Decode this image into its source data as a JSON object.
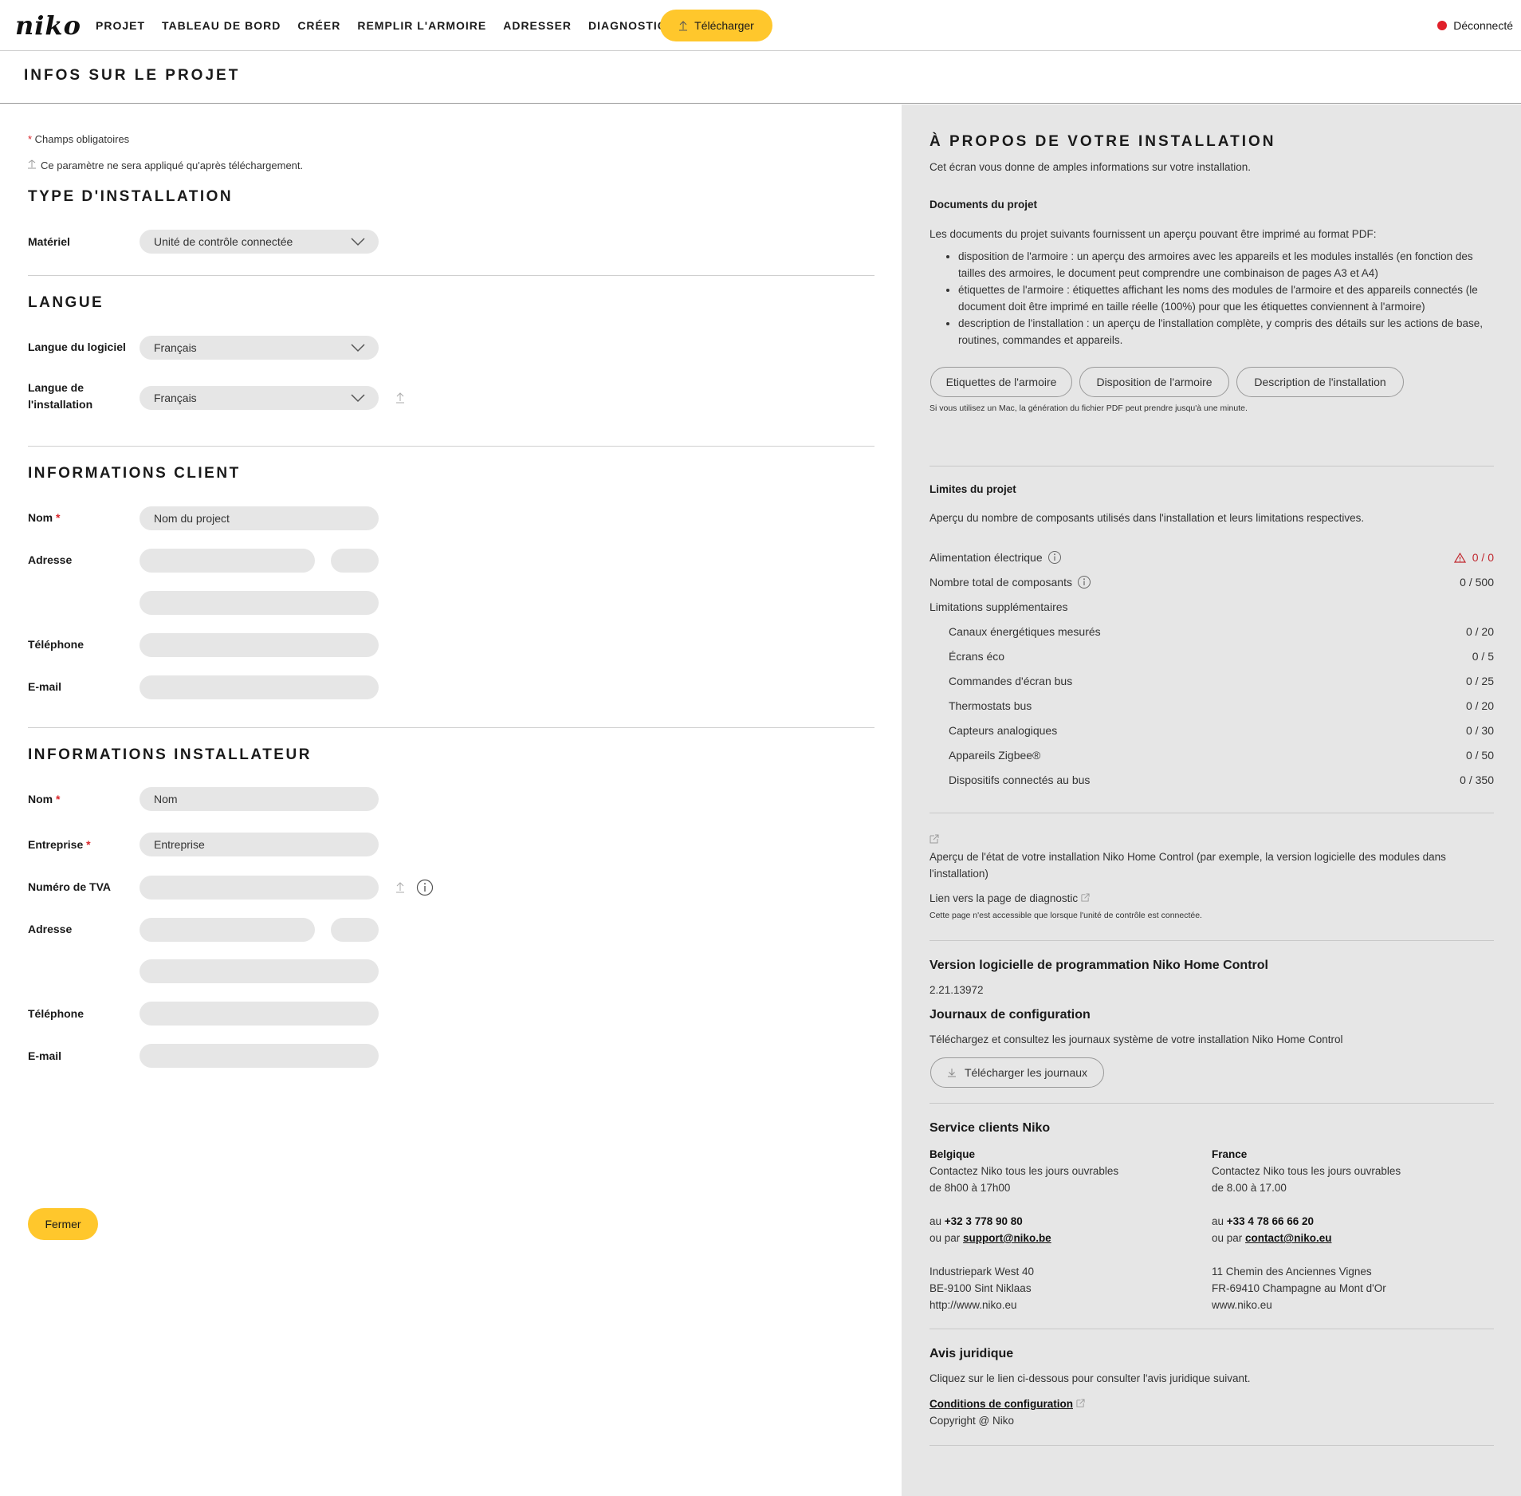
{
  "app": {
    "logo": "niko",
    "nav": [
      "PROJET",
      "TABLEAU DE BORD",
      "CRÉER",
      "REMPLIR L'ARMOIRE",
      "ADRESSER",
      "DIAGNOSTIC"
    ],
    "upload_label": "Télécharger",
    "status_label": "Déconnecté",
    "status_color": "#e0202a",
    "accent": "#ffc72c"
  },
  "page": {
    "title": "INFOS SUR LE PROJET"
  },
  "form": {
    "required_note": "Champs obligatoires",
    "upload_note": "Ce paramètre ne sera appliqué qu'après téléchargement.",
    "install_type": {
      "title": "TYPE D'INSTALLATION",
      "material_label": "Matériel",
      "material_value": "Unité de contrôle connectée"
    },
    "language": {
      "title": "LANGUE",
      "software_label": "Langue du logiciel",
      "software_value": "Français",
      "install_label_1": "Langue de",
      "install_label_2": "l'installation",
      "install_value": "Français"
    },
    "client": {
      "title": "INFORMATIONS CLIENT",
      "name_label": "Nom",
      "name_value": "Nom du project",
      "address_label": "Adresse",
      "phone_label": "Téléphone",
      "email_label": "E-mail"
    },
    "installer": {
      "title": "INFORMATIONS INSTALLATEUR",
      "name_label": "Nom",
      "name_value": "Nom",
      "company_label": "Entreprise",
      "company_value": "Entreprise",
      "vat_label": "Numéro de TVA",
      "address_label": "Adresse",
      "phone_label": "Téléphone",
      "email_label": "E-mail"
    },
    "close_label": "Fermer"
  },
  "about": {
    "title": "À PROPOS DE VOTRE INSTALLATION",
    "intro": "Cet écran vous donne de amples informations sur votre installation.",
    "docs_title": "Documents du projet",
    "docs_intro": "Les documents du projet suivants fournissent un aperçu pouvant être imprimé au format PDF:",
    "bullets": [
      "disposition de l'armoire : un aperçu des armoires avec les appareils et les modules installés (en fonction des tailles des armoires, le document peut comprendre une combinaison de pages A3 et A4)",
      "étiquettes de l'armoire : étiquettes affichant les noms des modules de l'armoire et des appareils connectés (le document doit être imprimé en taille réelle (100%) pour que les étiquettes conviennent à l'armoire)",
      "description de l'installation : un aperçu de l'installation complète, y compris des détails sur les actions de base, routines, commandes et appareils."
    ],
    "doc_buttons": [
      "Etiquettes de l'armoire",
      "Disposition de l'armoire",
      "Description de l'installation"
    ],
    "mac_note": "Si vous utilisez un Mac, la génération du fichier PDF peut prendre jusqu'à une minute.",
    "limits_title": "Limites du projet",
    "limits_intro": "Aperçu du nombre de composants utilisés dans l'installation et leurs limitations respectives.",
    "limits": [
      {
        "label": "Alimentation électrique",
        "value": "0 / 0"
      },
      {
        "label": "Nombre total de composants",
        "value": "0 / 500"
      },
      {
        "label": "Limitations supplémentaires",
        "value": ""
      }
    ],
    "sub_limits": [
      {
        "label": "Canaux énergétiques mesurés",
        "value": "0 / 20"
      },
      {
        "label": "Écrans éco",
        "value": "0 / 5"
      },
      {
        "label": "Commandes d'écran bus",
        "value": "0 / 25"
      },
      {
        "label": "Thermostats bus",
        "value": "0 / 20"
      },
      {
        "label": "Capteurs analogiques",
        "value": "0 / 30"
      },
      {
        "label": "Appareils Zigbee®",
        "value": "0 / 50"
      },
      {
        "label": "Dispositifs connectés au bus",
        "value": "0 / 350"
      }
    ],
    "diag_text": "Aperçu de l'état de votre installation Niko Home Control (par exemple, la version logicielle des modules dans l'installation)",
    "diag_link": "Lien vers la page de diagnostic",
    "diag_note": "Cette page n'est accessible que lorsque l'unité de contrôle est connectée.",
    "version_title": "Version logicielle de programmation Niko Home Control",
    "version_value": "2.21.13972",
    "logs_title": "Journaux de configuration",
    "logs_text": "Téléchargez et consultez les journaux système de votre installation Niko Home Control",
    "logs_button": "Télécharger les journaux",
    "service_title": "Service clients Niko",
    "belgium": {
      "country": "Belgique",
      "line1": "Contactez Niko tous les jours ouvrables",
      "line2": "de 8h00 à 17h00",
      "phone_prefix": "au ",
      "phone": "+32 3 778 90 80",
      "mail_prefix": "ou par ",
      "mail": "support@niko.be",
      "addr1": "Industriepark West 40",
      "addr2": "BE-9100 Sint Niklaas",
      "web": "http://www.niko.eu"
    },
    "france": {
      "country": "France",
      "line1": "Contactez Niko tous les jours ouvrables",
      "line2": "de 8.00 à 17.00",
      "phone_prefix": "au ",
      "phone": "+33 4 78 66 66 20",
      "mail_prefix": "ou par ",
      "mail": "contact@niko.eu",
      "addr1": "11 Chemin des Anciennes Vignes",
      "addr2": "FR-69410 Champagne au Mont d'Or",
      "web": "www.niko.eu"
    },
    "legal_title": "Avis juridique",
    "legal_text": "Cliquez sur le lien ci-dessous pour consulter l'avis juridique suivant.",
    "legal_link": "Conditions de configuration",
    "copyright": "Copyright @ Niko"
  }
}
